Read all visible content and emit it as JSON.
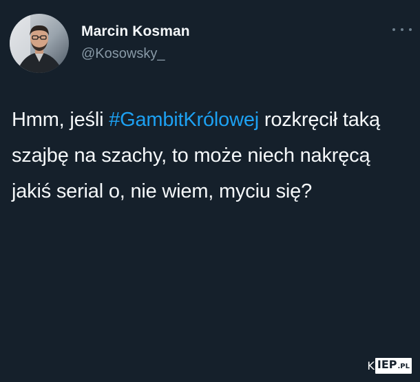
{
  "tweet": {
    "author": {
      "display_name": "Marcin Kosman",
      "handle": "@Kosowsky_"
    },
    "text_before": "Hmm, jeśli ",
    "hashtag": "#GambitKrólowej",
    "text_after": " rozkręcił taką szajbę na szachy, to może niech nakręcą jakiś serial o, nie wiem, myciu się?",
    "more_icon": "more-horizontal-icon"
  },
  "watermark": {
    "prefix": "K",
    "main": "IEP",
    "suffix": ".PL"
  },
  "colors": {
    "background": "#15202b",
    "text": "#f5f8fa",
    "secondary_text": "#8899a6",
    "link": "#1da1f2"
  }
}
